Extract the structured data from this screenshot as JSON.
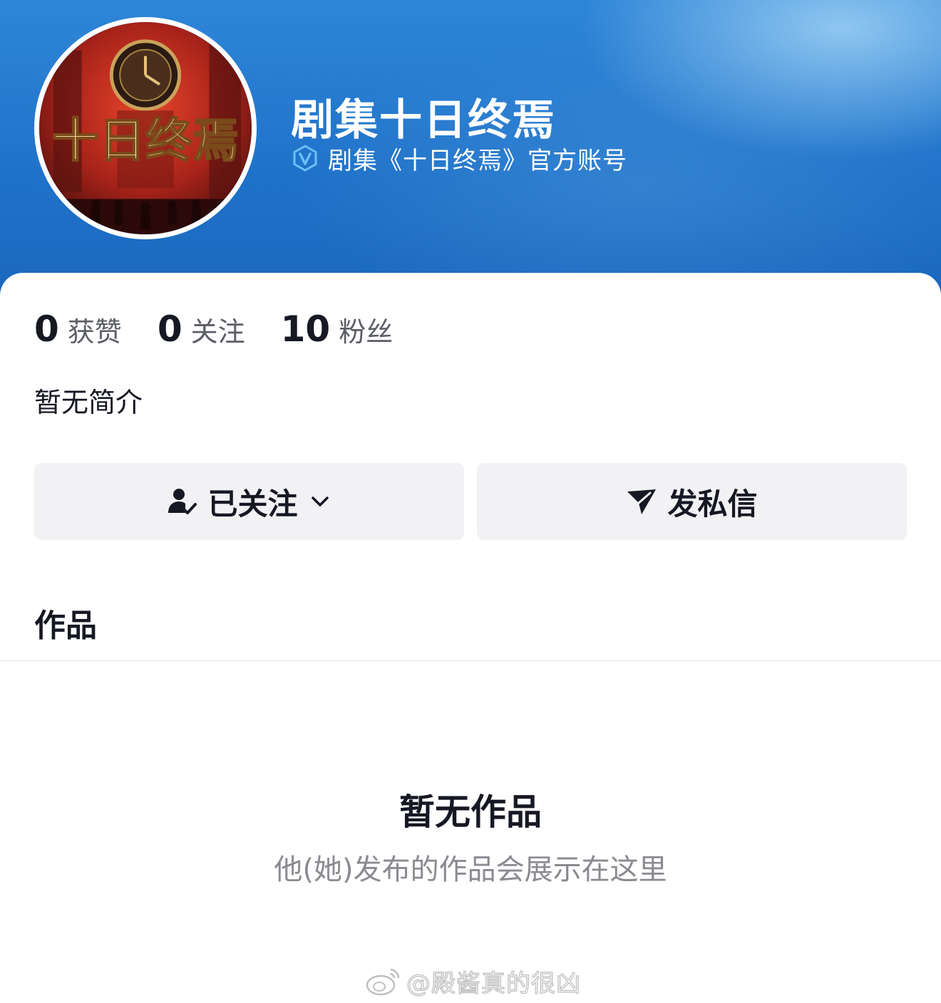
{
  "profile": {
    "name": "剧集十日终焉",
    "verification": "剧集《十日终焉》官方账号",
    "avatar_text": "十日终焉",
    "bio": "暂无简介"
  },
  "stats": [
    {
      "num": "0",
      "label": "获赞"
    },
    {
      "num": "0",
      "label": "关注"
    },
    {
      "num": "10",
      "label": "粉丝"
    }
  ],
  "actions": {
    "follow_label": "已关注",
    "message_label": "发私信"
  },
  "works": {
    "section_title": "作品",
    "empty_title": "暂无作品",
    "empty_subtitle": "他(她)发布的作品会展示在这里"
  },
  "watermark": {
    "text": "@殿酱真的很凶"
  },
  "icons": {
    "verify": "verified-v-icon",
    "follow": "user-check-icon",
    "chevron": "chevron-down-icon",
    "message": "send-icon",
    "watermark_logo": "weibo-logo-icon"
  },
  "colors": {
    "header_blue": "#1f72c9",
    "verify_icon": "#4aa8f0",
    "button_bg": "#f2f2f4",
    "text_primary": "#161823",
    "text_secondary": "#8a8b91"
  }
}
